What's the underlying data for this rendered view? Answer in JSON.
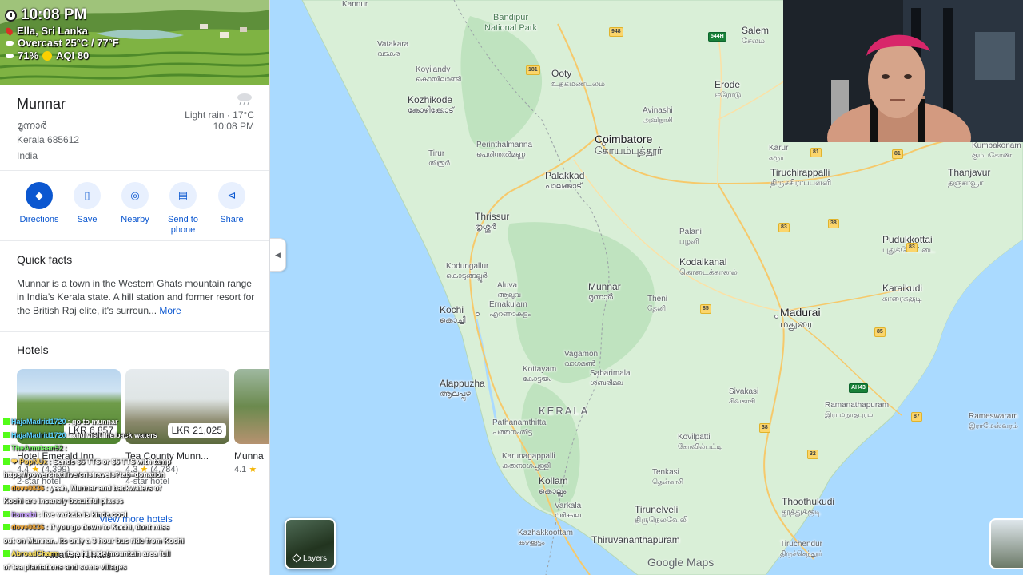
{
  "stream_overlay": {
    "time": "10:08 PM",
    "location": "Ella, Sri Lanka",
    "weather": "Overcast 25°C / 77°F",
    "humidity": "71%",
    "aqi": "AQI 80",
    "icons": {
      "clock": "clock-icon",
      "pin": "pin-icon",
      "cloud": "cloud-icon",
      "sun": "sun-icon"
    }
  },
  "place": {
    "name": "Munnar",
    "local_name": "മൂന്നാർ",
    "state_postal": "Kerala 685612",
    "country": "India",
    "weather_desc": "Light rain · 17°C",
    "local_time": "10:08 PM"
  },
  "actions": [
    {
      "label": "Directions",
      "icon": "directions-icon"
    },
    {
      "label": "Save",
      "icon": "bookmark-icon"
    },
    {
      "label": "Nearby",
      "icon": "nearby-icon"
    },
    {
      "label": "Send to phone",
      "icon": "send-to-phone-icon"
    },
    {
      "label": "Share",
      "icon": "share-icon"
    }
  ],
  "quick_facts": {
    "title": "Quick facts",
    "body": "Munnar is a town in the Western Ghats mountain range in India’s Kerala state. A hill station and former resort for the British Raj elite, it's surroun...",
    "more": "More"
  },
  "hotels": {
    "title": "Hotels",
    "items": [
      {
        "name": "Hotel Emerald Inn",
        "price": "LKR 6,857",
        "rating": "4.4",
        "reviews": "(4,399)",
        "type": "2-star hotel"
      },
      {
        "name": "Tea County Munn...",
        "price": "LKR 21,025",
        "rating": "4.3",
        "reviews": "(4,784)",
        "type": "4-star hotel"
      },
      {
        "name": "Munna",
        "price": "",
        "rating": "4.1",
        "reviews": "",
        "type": ""
      }
    ],
    "view_more": "View more hotels",
    "vacation": "Vacation rentals"
  },
  "chat": [
    {
      "user": "HajaMadrid1720",
      "msg": ": go to munnar",
      "color": "#5fd3ff"
    },
    {
      "user": "HajaMadrid1720",
      "msg": ": and visit the back waters",
      "color": "#5fd3ff"
    },
    {
      "user": "TheAmutaan52",
      "msg": ": ",
      "color": "#7cff6b"
    },
    {
      "user": "❤ PopNUx",
      "msg": ": Sends $5 TTS or $5 TTS with tamp",
      "color": "#ffd35c"
    },
    {
      "user": "",
      "msg": "https://powerchat.live/cristravels?tab=donation",
      "color": "#ffffff"
    },
    {
      "user": "dove0836",
      "msg": ": yeah, Munnar and backwaters of",
      "color": "#ffb13b"
    },
    {
      "user": "",
      "msg": "Kochi are insanely beautiful places",
      "color": "#ffffff"
    },
    {
      "user": "itsmabi",
      "msg": ": live varkala is kinda cool",
      "color": "#c9a1ff"
    },
    {
      "user": "dove0836",
      "msg": ": if you go down to Kochi, dont miss",
      "color": "#ffb13b"
    },
    {
      "user": "",
      "msg": "out on Munnar.. its only a 3 hour bus ride from Kochi",
      "color": "#ffffff"
    },
    {
      "user": "AbroadCharm",
      "msg": ": its a hillside/mountain area full",
      "color": "#ffe45c"
    },
    {
      "user": "",
      "msg": "of tea plantations and some villages",
      "color": "#ffffff"
    }
  ],
  "map": {
    "labels": {
      "kannur": "Kannur",
      "bandipur": "Bandipur\nNational Park",
      "vatakara": "Vatakara",
      "vatakara_ml": "വടകര",
      "koyilandy": "Koyilandy",
      "koyilandy_ml": "കൊയിലാണ്ടി",
      "ooty": "Ooty",
      "ooty_ta": "உதகமண்டலம்",
      "salem": "Salem",
      "salem_ta": "சேலம்",
      "erode": "Erode",
      "erode_ta": "ஈரோடு",
      "kozhikode": "Kozhikode",
      "kozhikode_ml": "കോഴിക്കോട്",
      "avinashi": "Avinashi",
      "avinashi_ta": "அவிநாசி",
      "coimbatore": "Coimbatore",
      "coimbatore_ta": "கோயம்புத்தூர்",
      "karur": "Karur",
      "karur_ta": "கரூர்",
      "tiruchirappalli": "Tiruchirappalli",
      "tiruchirappalli_ta": "திருச்சிராப்பள்ளி",
      "thanjavur": "Thanjavur",
      "thanjavur_ta": "தஞ்சாவூர்",
      "kumbakonam": "Kumbakonam",
      "kumbakonam_ta": "கும்பகோண",
      "tirur": "Tirur",
      "tirur_ml": "തിരൂർ",
      "perinthalmanna": "Perinthalmanna",
      "perinthalmanna_ml": "പെരിന്തൽമണ്ണ",
      "palakkad": "Palakkad",
      "palakkad_ml": "പാലക്കാട്",
      "thrissur": "Thrissur",
      "thrissur_ml": "തൃശ്ശൂർ",
      "palani": "Palani",
      "palani_ta": "பழனி",
      "pudukkottai": "Pudukkottai",
      "pudukkottai_ta": "புதுக்கோட்டை",
      "kodungallur": "Kodungallur",
      "kodungallur_ml": "കൊടുങ്ങല്ലൂർ",
      "kodaikanal": "Kodaikanal",
      "kodaikanal_ta": "கொடைக்கானல்",
      "aluva": "Aluva",
      "aluva_ml": "ആലുവ",
      "ernakulam": "Ernakulam",
      "ernakulam_ml": "എറണാകുളം",
      "munnar": "Munnar",
      "munnar_ml": "മൂന്നാർ",
      "theni": "Theni",
      "theni_ta": "தேனி",
      "karaikudi": "Karaikudi",
      "karaikudi_ta": "காரைக்குடி",
      "kochi": "Kochi",
      "kochi_ml": "കൊച്ചി",
      "madurai": "Madurai",
      "madurai_ta": "மதுரை",
      "vagamon": "Vagamon",
      "vagamon_ml": "വാഗമൺ",
      "alappuzha": "Alappuzha",
      "alappuzha_ml": "ആലപ്പുഴ",
      "kottayam": "Kottayam",
      "kottayam_ml": "കോട്ടയം",
      "sabarimala": "Sabarimala",
      "sabarimala_ml": "ശബരിമല",
      "sivakasi": "Sivakasi",
      "sivakasi_ta": "சிவகாசி",
      "ramanathapuram": "Ramanathapuram",
      "ramanathapuram_ta": "இராமநாதபுரம்",
      "rameswaram": "Rameswaram",
      "rameswaram_ta": "இராமேஸ்வரம்",
      "kerala": "KERALA",
      "pathanamthitta": "Pathanamthitta",
      "pathanamthitta_ml": "പത്തനംതിട്ട",
      "kovilpatti": "Kovilpatti",
      "kovilpatti_ta": "கோவில்பட்டி",
      "karunagappalli": "Karunagappalli",
      "karunagappalli_ml": "കരുനാഗപ്പള്ളി",
      "kollam": "Kollam",
      "kollam_ml": "കൊല്ലം",
      "tenkasi": "Tenkasi",
      "tenkasi_ta": "தென்காசி",
      "varkala": "Varkala",
      "varkala_ml": "വർക്കല",
      "tirunelveli": "Tirunelveli",
      "tirunelveli_ta": "திருநெல்வேலி",
      "thoothukudi": "Thoothukudi",
      "thoothukudi_ta": "தூத்துக்குடி",
      "kazhakkoottam": "Kazhakkoottam",
      "kazhakkoottam_ml": "കഴക്കൂട്ടം",
      "thiruvananthapuram": "Thiruvananthapuram",
      "tiruchendur": "Tiruchendur",
      "tiruchendur_ta": "திருச்செந்தூர்"
    },
    "shields": [
      "948",
      "544H",
      "181",
      "81",
      "81",
      "83",
      "83",
      "38",
      "85",
      "85",
      "AH43",
      "87",
      "38",
      "32"
    ],
    "layers_label": "Layers",
    "attribution": "Google Maps"
  },
  "colors": {
    "accent": "#0b57d0",
    "water": "#aadaff",
    "land": "#d8efd9"
  }
}
